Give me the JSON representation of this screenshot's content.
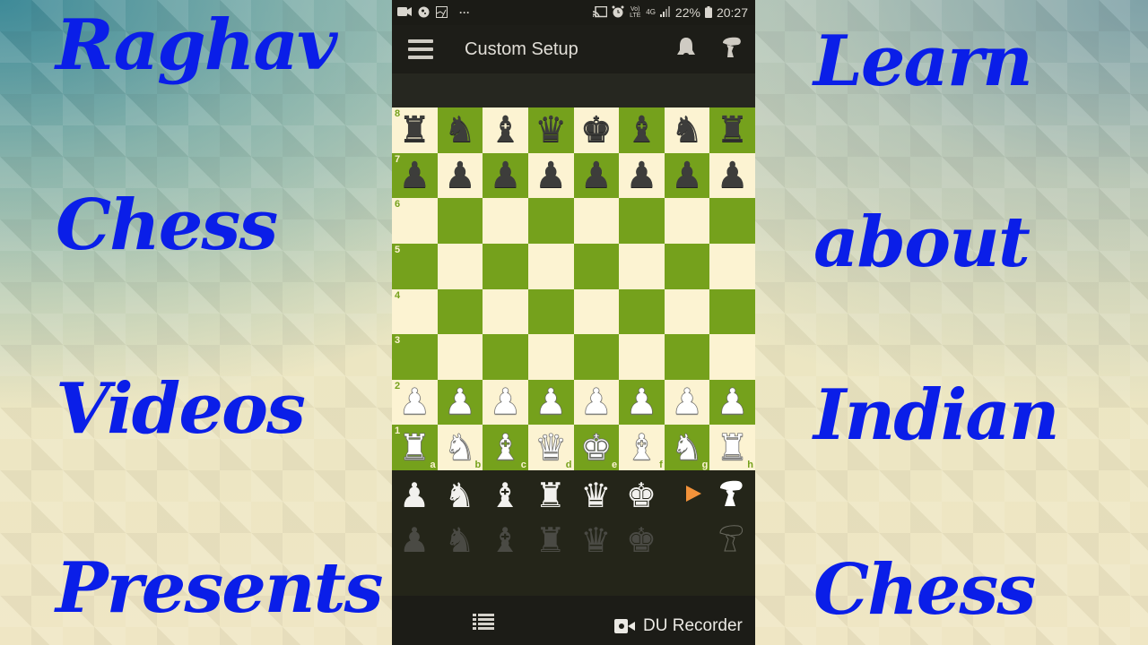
{
  "overlay": {
    "left_words": [
      "Raghav",
      "Chess",
      "Videos",
      "Presents"
    ],
    "right_words": [
      "Learn",
      "about",
      "Indian",
      "Chess"
    ],
    "text_color": "#0a1ee8"
  },
  "statusbar": {
    "left_icons": [
      "video-camera-icon",
      "music-disc-icon",
      "gallery-edit-icon",
      "more-dots-icon"
    ],
    "more": "···",
    "right_icons": [
      "cast-icon",
      "alarm-icon",
      "volte-icon",
      "4g-icon",
      "signal-icon",
      "battery-icon"
    ],
    "volte": "Vo) LTE",
    "network": "4G",
    "battery": "22%",
    "time": "20:27"
  },
  "appbar": {
    "title": "Custom Setup",
    "menu_icon": "hamburger-menu-icon",
    "actions": [
      "bell-icon",
      "hand-pawn-icon"
    ]
  },
  "board": {
    "colors": {
      "light": "#fcf3d2",
      "dark": "#75a11c"
    },
    "ranks": [
      "8",
      "7",
      "6",
      "5",
      "4",
      "3",
      "2",
      "1"
    ],
    "files": [
      "a",
      "b",
      "c",
      "d",
      "e",
      "f",
      "g",
      "h"
    ],
    "position": [
      [
        "bR",
        "bN",
        "bB",
        "bQ",
        "bK",
        "bB",
        "bN",
        "bR"
      ],
      [
        "bP",
        "bP",
        "bP",
        "bP",
        "bP",
        "bP",
        "bP",
        "bP"
      ],
      [
        "",
        "",
        "",
        "",
        "",
        "",
        "",
        ""
      ],
      [
        "",
        "",
        "",
        "",
        "",
        "",
        "",
        ""
      ],
      [
        "",
        "",
        "",
        "",
        "",
        "",
        "",
        ""
      ],
      [
        "",
        "",
        "",
        "",
        "",
        "",
        "",
        ""
      ],
      [
        "wP",
        "wP",
        "wP",
        "wP",
        "wP",
        "wP",
        "wP",
        "wP"
      ],
      [
        "wR",
        "wN",
        "wB",
        "wQ",
        "wK",
        "wB",
        "wN",
        "wR"
      ]
    ]
  },
  "tray": {
    "white_pieces": [
      "wP",
      "wN",
      "wB",
      "wR",
      "wQ",
      "wK"
    ],
    "black_pieces": [
      "bP",
      "bN",
      "bB",
      "bR",
      "bQ",
      "bK"
    ],
    "selected_color": "white",
    "arrow_color": "#f2923a"
  },
  "bottombar": {
    "list_icon": "list-icon",
    "recorder_label": "DU Recorder"
  }
}
